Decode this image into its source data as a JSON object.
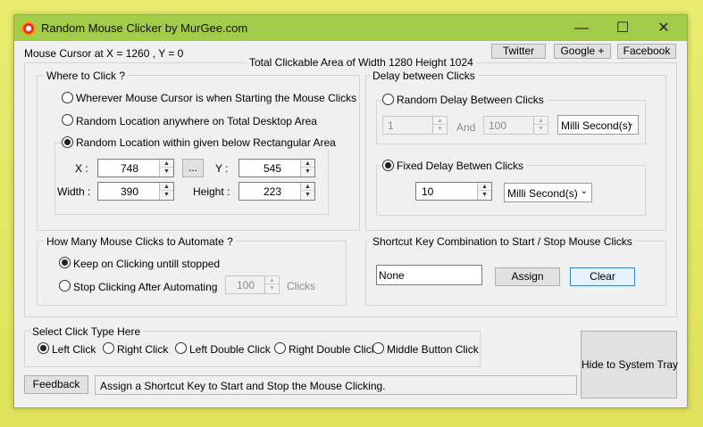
{
  "window": {
    "title": "Random Mouse Clicker by MurGee.com",
    "minimize_glyph": "—",
    "maximize_glyph": "☐",
    "close_glyph": "✕"
  },
  "header": {
    "cursor_text": "Mouse Cursor at X = 1260 , Y = 0",
    "clickable_area_text": "Total Clickable Area of Width 1280 Height 1024",
    "twitter_label": "Twitter",
    "google_label": "Google +",
    "facebook_label": "Facebook"
  },
  "where_to_click": {
    "title": "Where to Click ?",
    "option_cursor": "Wherever Mouse Cursor is when Starting the Mouse Clicks",
    "option_desktop": "Random Location anywhere on Total Desktop Area",
    "option_rect": "Random Location within given below Rectangular Area",
    "x_label": "X :",
    "x_value": "748",
    "pick_label": "...",
    "y_label": "Y :",
    "y_value": "545",
    "width_label": "Width :",
    "width_value": "390",
    "height_label": "Height :",
    "height_value": "223"
  },
  "delay": {
    "title": "Delay between Clicks",
    "random_label": "Random Delay Between Clicks",
    "min_value": "1",
    "and_label": "And",
    "max_value": "100",
    "random_unit": "Milli Second(s)",
    "fixed_label": "Fixed Delay Betwen Clicks",
    "fixed_value": "10",
    "fixed_unit": "Milli Second(s)"
  },
  "how_many": {
    "title": "How Many Mouse Clicks to Automate ?",
    "option_keep": "Keep on Clicking untill stopped",
    "option_stop": "Stop Clicking After Automating",
    "count_value": "100",
    "clicks_label": "Clicks"
  },
  "shortcut": {
    "title": "Shortcut Key Combination to Start / Stop Mouse Clicks",
    "value": "None",
    "assign_label": "Assign",
    "clear_label": "Clear"
  },
  "click_type": {
    "title": "Select Click Type Here",
    "left": "Left Click",
    "right": "Right Click",
    "left_double": "Left Double Click",
    "right_double": "Right Double Click",
    "middle": "Middle Button Click"
  },
  "footer": {
    "feedback_label": "Feedback",
    "status_text": "Assign a Shortcut Key to Start and Stop the Mouse Clicking.",
    "hide_tray_label": "Hide to System Tray"
  }
}
